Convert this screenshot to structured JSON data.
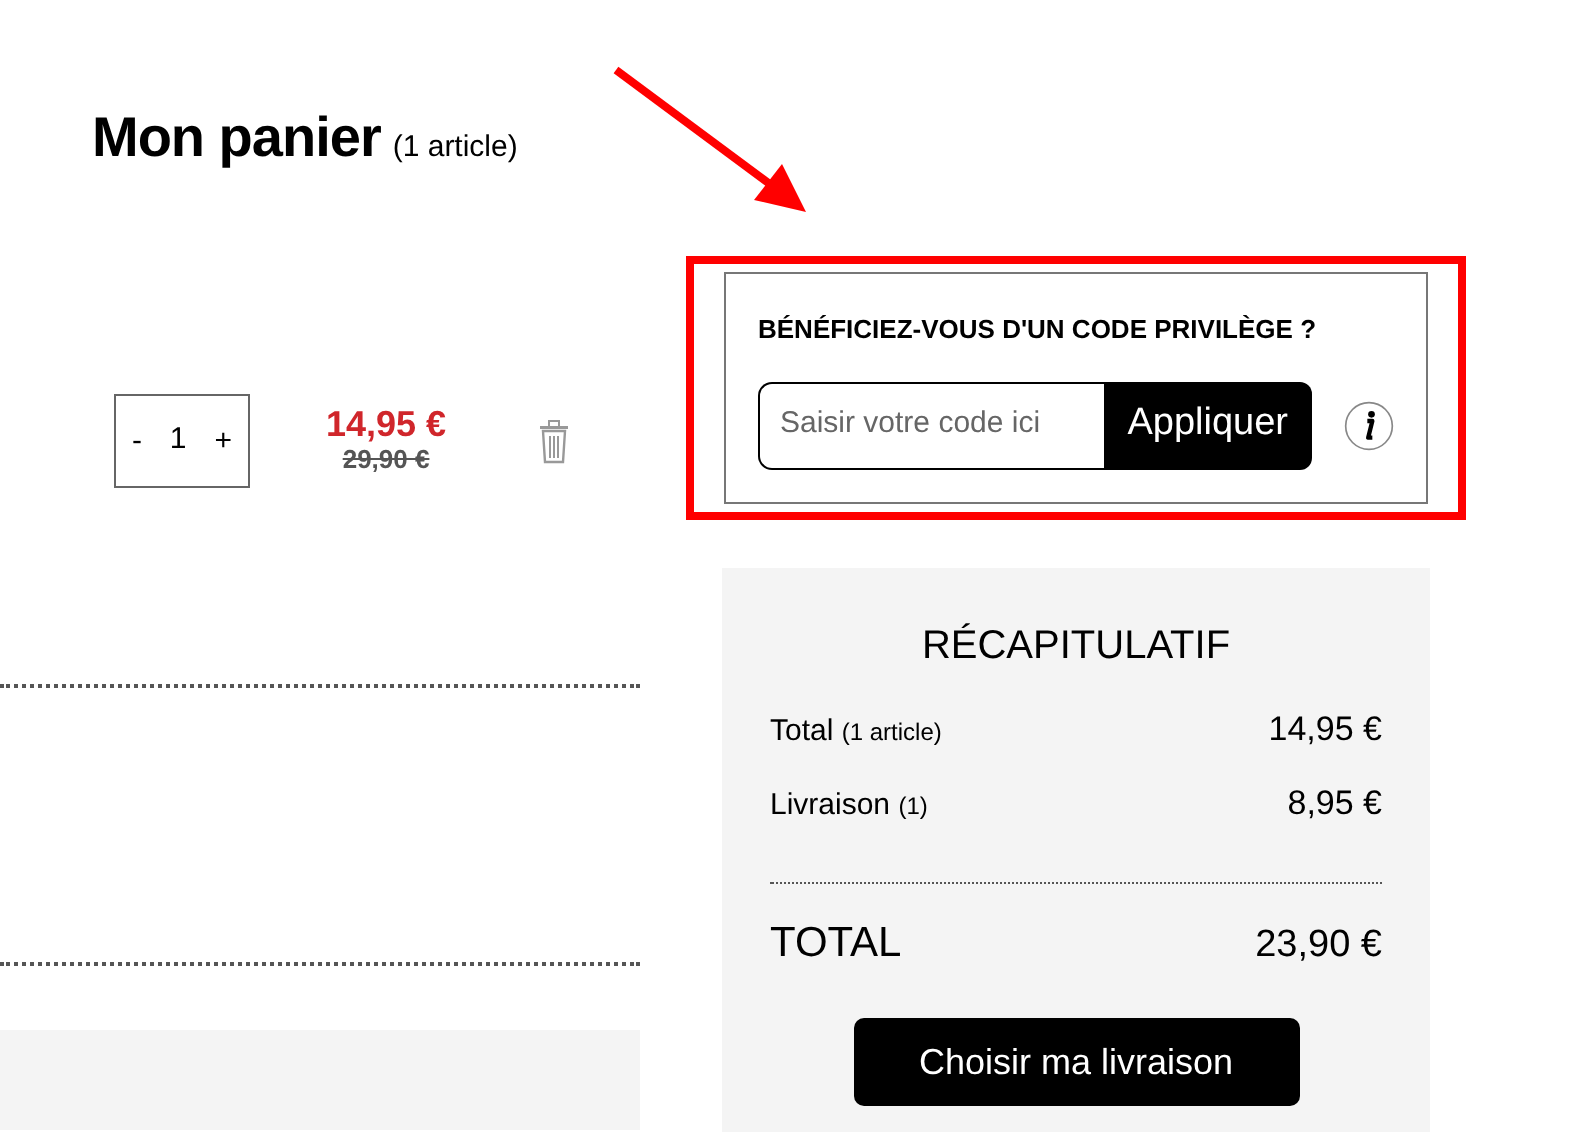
{
  "page_title": {
    "title": "Mon panier",
    "count": "(1 article)"
  },
  "cart_item": {
    "decrement": "-",
    "quantity": "1",
    "increment": "+",
    "price": "14,95 €",
    "old_price": "29,90 €"
  },
  "promo": {
    "highlighted": true,
    "heading": "BÉNÉFICIEZ-VOUS D'UN CODE PRIVILÈGE ?",
    "placeholder": "Saisir votre code ici",
    "apply_button": "Appliquer"
  },
  "summary": {
    "title": "RÉCAPITULATIF",
    "lines": [
      {
        "label": "Total",
        "note": "(1 article)",
        "amount": "14,95 €"
      },
      {
        "label": "Livraison",
        "note": "(1)",
        "amount": "8,95 €"
      }
    ],
    "total": {
      "label": "TOTAL",
      "amount": "23,90 €"
    },
    "button": "Choisir ma livraison"
  }
}
